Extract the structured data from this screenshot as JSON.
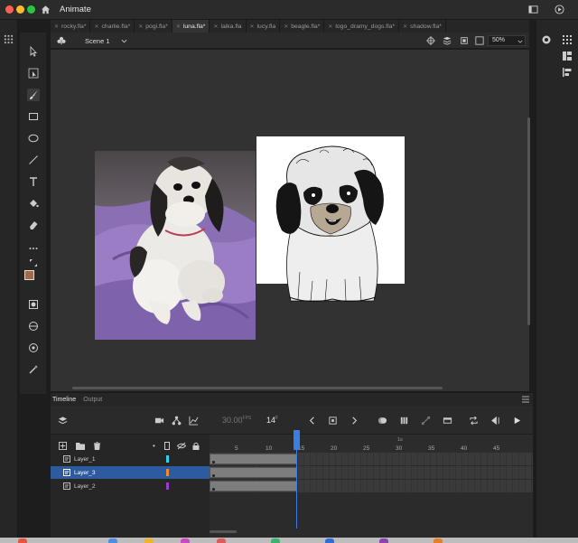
{
  "app": {
    "title": "Animate"
  },
  "tabs": [
    {
      "label": "rocky.fla*",
      "active": false
    },
    {
      "label": "charlie.fla*",
      "active": false
    },
    {
      "label": "pogi.fla*",
      "active": false
    },
    {
      "label": "luna.fla*",
      "active": true
    },
    {
      "label": "laika.fla",
      "active": false
    },
    {
      "label": "lucy.fla",
      "active": false
    },
    {
      "label": "beagle.fla*",
      "active": false
    },
    {
      "label": "logo_dramy_dogs.fla*",
      "active": false
    },
    {
      "label": "shadow.fla*",
      "active": false
    }
  ],
  "editbar": {
    "scene": "Scene 1",
    "zoom": "50%"
  },
  "timeline": {
    "tabs": [
      {
        "label": "Timeline",
        "active": true
      },
      {
        "label": "Output",
        "active": false
      }
    ],
    "fps": "30.00",
    "fps_unit": "FPS",
    "current_frame": "14",
    "frame_unit": "F",
    "ruler": {
      "seconds": "1s",
      "numbers": [
        "5",
        "10",
        "15",
        "20",
        "25",
        "30",
        "35",
        "40",
        "45"
      ]
    },
    "layers": [
      {
        "name": "Layer_1",
        "color": "#2fd0e8",
        "active": false
      },
      {
        "name": "Layer_3",
        "color": "#f08a2a",
        "active": true
      },
      {
        "name": "Layer_2",
        "color": "#9a3ec8",
        "active": false
      }
    ]
  },
  "colors": {
    "stroke": "#a0694a",
    "fill": "#1a1a1a",
    "accent": "#3b7de0"
  }
}
